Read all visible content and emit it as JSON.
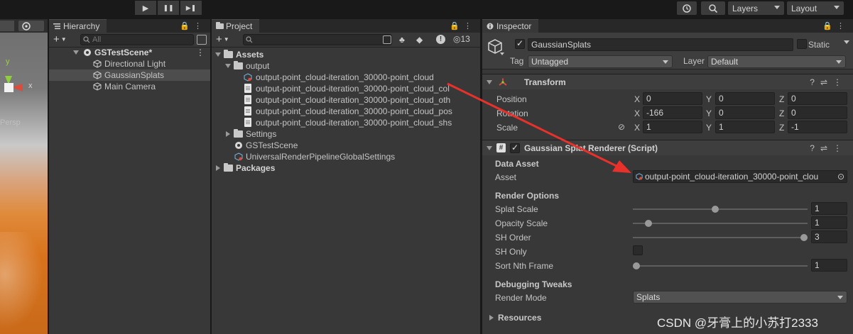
{
  "toolbar": {
    "play_icon": "▶",
    "pause_icon": "❚❚",
    "step_icon": "▶❚",
    "history_icon": "history-icon",
    "search_icon": "search-icon",
    "layers_label": "Layers",
    "layout_label": "Layout"
  },
  "scene_view": {
    "axis_y": "y",
    "axis_x": "x",
    "persp_label": "Persp"
  },
  "hierarchy": {
    "tab_label": "Hierarchy",
    "search_placeholder": "All",
    "scene_name": "GSTestScene*",
    "items": [
      "Directional Light",
      "GaussianSplats",
      "Main Camera"
    ]
  },
  "project": {
    "tab_label": "Project",
    "hidden_count": "13",
    "assets_label": "Assets",
    "output_label": "output",
    "output_files": [
      "output-point_cloud-iteration_30000-point_cloud",
      "output-point_cloud-iteration_30000-point_cloud_col",
      "output-point_cloud-iteration_30000-point_cloud_oth",
      "output-point_cloud-iteration_30000-point_cloud_pos",
      "output-point_cloud-iteration_30000-point_cloud_shs"
    ],
    "settings_label": "Settings",
    "scene_asset": "GSTestScene",
    "urp_settings": "UniversalRenderPipelineGlobalSettings",
    "packages_label": "Packages"
  },
  "inspector": {
    "tab_label": "Inspector",
    "object_name": "GaussianSplats",
    "static_label": "Static",
    "tag_label": "Tag",
    "tag_value": "Untagged",
    "layer_label": "Layer",
    "layer_value": "Default",
    "transform": {
      "title": "Transform",
      "position_label": "Position",
      "rotation_label": "Rotation",
      "scale_label": "Scale",
      "axis_x": "X",
      "axis_y": "Y",
      "axis_z": "Z",
      "position": [
        "0",
        "0",
        "0"
      ],
      "rotation": [
        "-166",
        "0",
        "0"
      ],
      "scale": [
        "1",
        "1",
        "-1"
      ]
    },
    "renderer": {
      "title": "Gaussian Splat Renderer (Script)",
      "data_asset_section": "Data Asset",
      "asset_label": "Asset",
      "asset_value": "output-point_cloud-iteration_30000-point_clou",
      "render_options_section": "Render Options",
      "splat_scale_label": "Splat Scale",
      "splat_scale": "1",
      "splat_scale_level": 0.47,
      "opacity_scale_label": "Opacity Scale",
      "opacity_scale": "1",
      "opacity_scale_level": 0.07,
      "sh_order_label": "SH Order",
      "sh_order": "3",
      "sh_order_level": 1.0,
      "sh_only_label": "SH Only",
      "sh_only": false,
      "sort_nth_label": "Sort Nth Frame",
      "sort_nth": "1",
      "sort_nth_level": 0.0,
      "debugging_section": "Debugging Tweaks",
      "render_mode_label": "Render Mode",
      "render_mode_value": "Splats",
      "resources_label": "Resources"
    }
  },
  "colors": {
    "arrow": "#e8312b",
    "selection": "#2c5d87",
    "transform_icon": "#e04a3a"
  },
  "watermark": "CSDN @牙膏上的小苏打2333"
}
